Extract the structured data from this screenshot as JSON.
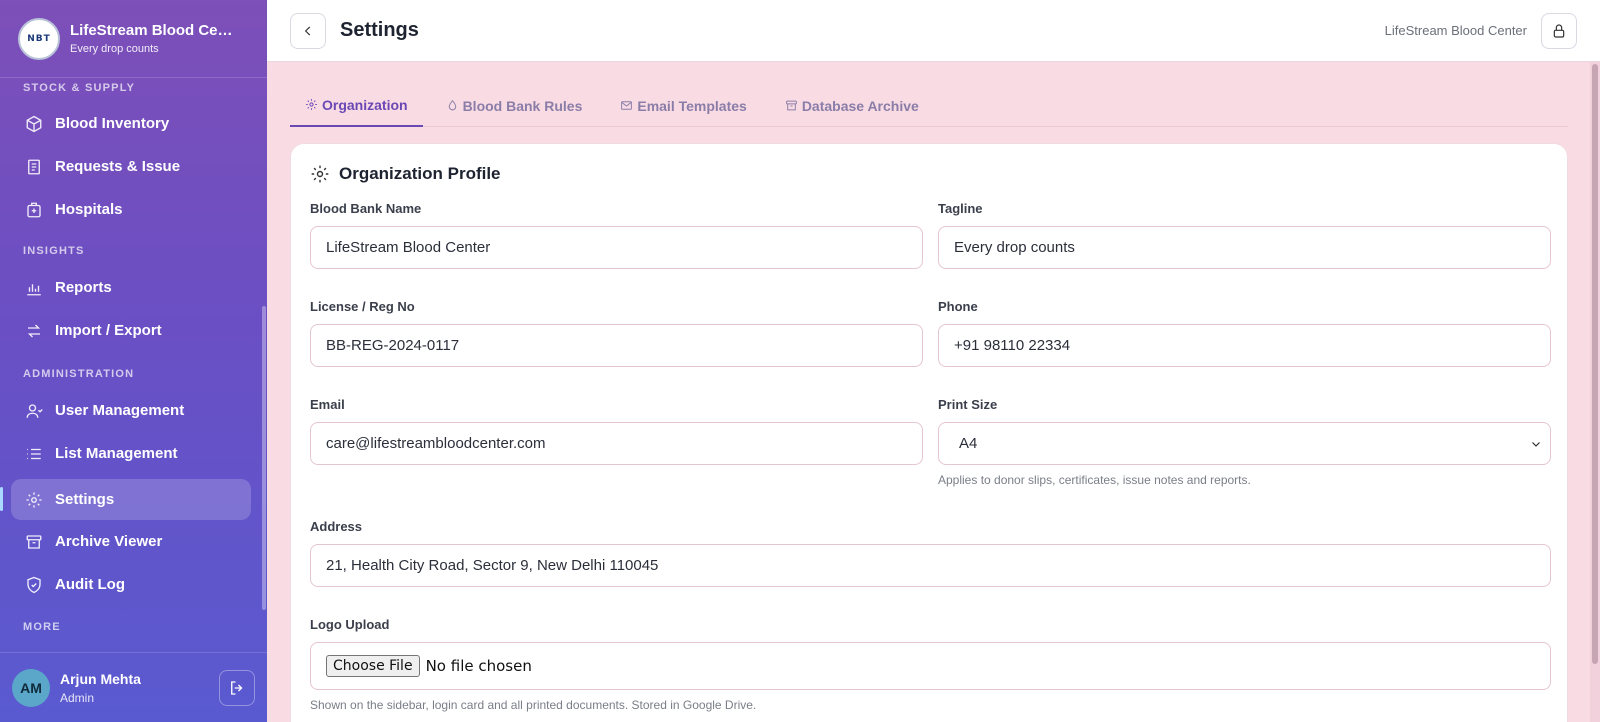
{
  "brand": {
    "logo_text": "NBT",
    "title": "LifeStream Blood Center",
    "tagline": "Every drop counts"
  },
  "sidebar": {
    "sections": [
      {
        "label": "STOCK & SUPPLY"
      },
      {
        "label": "INSIGHTS"
      },
      {
        "label": "ADMINISTRATION"
      },
      {
        "label": "MORE"
      }
    ],
    "items": [
      {
        "label": "Blood Inventory",
        "icon": "cube-icon"
      },
      {
        "label": "Requests & Issue",
        "icon": "document-icon"
      },
      {
        "label": "Hospitals",
        "icon": "hospital-icon"
      },
      {
        "label": "Reports",
        "icon": "bar-chart-icon"
      },
      {
        "label": "Import / Export",
        "icon": "swap-icon"
      },
      {
        "label": "User Management",
        "icon": "user-icon"
      },
      {
        "label": "List Management",
        "icon": "list-icon"
      },
      {
        "label": "Settings",
        "icon": "gear-icon",
        "active": true
      },
      {
        "label": "Archive Viewer",
        "icon": "archive-icon"
      },
      {
        "label": "Audit Log",
        "icon": "shield-icon"
      }
    ]
  },
  "user": {
    "initials": "AM",
    "name": "Arjun Mehta",
    "role": "Admin"
  },
  "header": {
    "title": "Settings",
    "org_name": "LifeStream Blood Center"
  },
  "tabs": [
    {
      "label": "Organization",
      "active": true
    },
    {
      "label": "Blood Bank Rules"
    },
    {
      "label": "Email Templates"
    },
    {
      "label": "Database Archive"
    }
  ],
  "profile": {
    "title": "Organization Profile",
    "fields": {
      "bank_name": {
        "label": "Blood Bank Name",
        "value": "LifeStream Blood Center"
      },
      "tagline": {
        "label": "Tagline",
        "value": "Every drop counts"
      },
      "license": {
        "label": "License / Reg No",
        "value": "BB-REG-2024-0117"
      },
      "phone": {
        "label": "Phone",
        "value": "+91 98110 22334"
      },
      "email": {
        "label": "Email",
        "value": "care@lifestreambloodcenter.com"
      },
      "print_size": {
        "label": "Print Size",
        "value": "A4",
        "help": "Applies to donor slips, certificates, issue notes and reports."
      },
      "address": {
        "label": "Address",
        "value": "21, Health City Road, Sector 9, New Delhi 110045"
      },
      "logo": {
        "label": "Logo Upload",
        "button": "Choose File",
        "status": "No file chosen",
        "help": "Shown on the sidebar, login card and all printed documents. Stored in Google Drive."
      }
    }
  },
  "colors": {
    "accent": "#6b49b5",
    "background": "#f9dbe4",
    "sidebar_top": "#7d4fb8",
    "sidebar_bottom": "#5a5ad0"
  }
}
